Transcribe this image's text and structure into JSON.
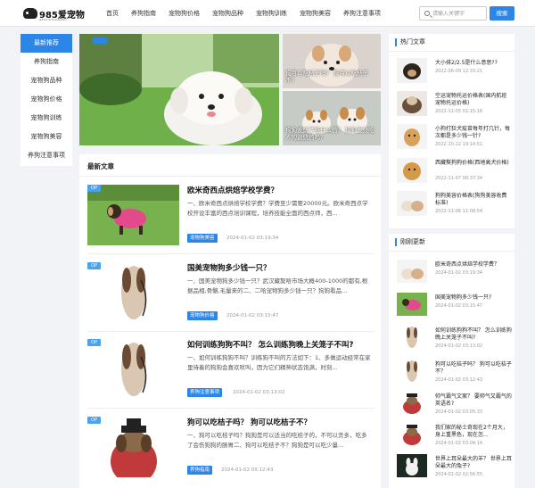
{
  "brand": {
    "name": "985爱宠物",
    "sub": "985AICHONGWU"
  },
  "nav": [
    "首页",
    "养狗指南",
    "宠物狗价格",
    "宠物狗品种",
    "宠物狗训练",
    "宠物狗美容",
    "养狗注意事项"
  ],
  "search": {
    "placeholder": "请输入关键字",
    "button": "搜索"
  },
  "categories": [
    "最新推荐",
    "养狗指南",
    "宠物狗品种",
    "宠物狗价格",
    "宠物狗训练",
    "宠物狗美容",
    "养狗注意事项"
  ],
  "banner": {
    "small_top_caption": "狗可以吃桔子吗？ 狗可以吃桔子不？",
    "small_bottom_caption": "狗狗发烧了吃什么药？ 狗狗发烧吃人的退烧药吗？"
  },
  "articles_title": "最新文章",
  "articles": [
    {
      "badge": "OP",
      "title": "欧米奇西点烘焙学校学费？",
      "desc": "一、欧米奇西点烘焙学校学费？学费至少需要20000元。欧米奇西点学校开设丰富的西点培训课程，培养技能全面的西点师，西...",
      "tag": "宠物狗美容",
      "time": "2024-01-02 03:19:34"
    },
    {
      "badge": "OP",
      "title": "国美宠物狗多少钱一只？",
      "desc": "一、国美宠物狗多少钱一只？武汉藏獒哈市场大概400-1000的都有,根据品相,骨骼,毛量来的二、二哈宠物狗多少钱一只？狗狗看品...",
      "tag": "宠物狗价格",
      "time": "2024-01-02 03:15:47"
    },
    {
      "badge": "OP",
      "title": "如何训练狗狗不叫？ 怎么训练狗晚上关笼子不叫?",
      "desc": "一、如何训练狗狗不叫？训练狗不叫的方法如下：1、多做运动经常在家里待着的狗狗会喜欢吠叫，因为它们精神状态饱满，时刻...",
      "tag": "养狗注意事项",
      "time": "2024-01-02 03:13:02"
    },
    {
      "badge": "OP",
      "title": "狗可以吃桔子吗？ 狗可以吃桔子不？",
      "desc": "一、狗可以吃桔子吗？狗狗是可以适当的吃桔子的，不可以贪多，吃多了会伤狗狗的肠胃二、狗可以吃桔子不？狗狗是可以吃少量...",
      "tag": "养狗指南",
      "time": "2024-01-02 03:12:43"
    }
  ],
  "hot": {
    "title": "热门文章",
    "items": [
      {
        "text": "大小排2/2.5是什么意思??",
        "time": "2022-06-09 12:33:21"
      },
      {
        "text": "空运宠物托运价格表(国内航班宠物托运价格)",
        "time": "2022-11-05 02:15:18"
      },
      {
        "text": "小狗打狂犬疫苗每年打几针，每次都是多少钱一针?",
        "time": "2022-10-22 19:14:51"
      },
      {
        "text": "西藏獒狗狗价格(西地高犬价格)",
        "time": "2022-11-07 08:37:34"
      },
      {
        "text": "狗狗美容价格表(狗狗美容收费标准)",
        "time": "2022-11-06 11:00:54"
      }
    ]
  },
  "newest": {
    "title": "刚刚更新",
    "items": [
      {
        "text": "欧米奇西点烘焙学校学费？",
        "time": "2024-01-02 03:19:34"
      },
      {
        "text": "国美宠物狗多少钱一只?",
        "time": "2024-01-02 03:15:47"
      },
      {
        "text": "如何训练狗狗不叫？ 怎么训练狗晚上关笼子不叫?",
        "time": "2024-01-02 03:13:02"
      },
      {
        "text": "狗可以吃桔子吗？ 狗可以吃桔子不？",
        "time": "2024-01-02 03:12:43"
      },
      {
        "text": "帅气霸气文案？ 要帅气又霸气的英语名?",
        "time": "2024-01-02 03:05:33"
      },
      {
        "text": "我们家的秘士奇现在2个月大，身上重黑色，现在怎...",
        "time": "2024-01-02 03:04:14"
      },
      {
        "text": "世界上耳朵最大的羊？ 世界上耳朵最大的兔子?",
        "time": "2024-01-02 02:56:55"
      }
    ]
  }
}
